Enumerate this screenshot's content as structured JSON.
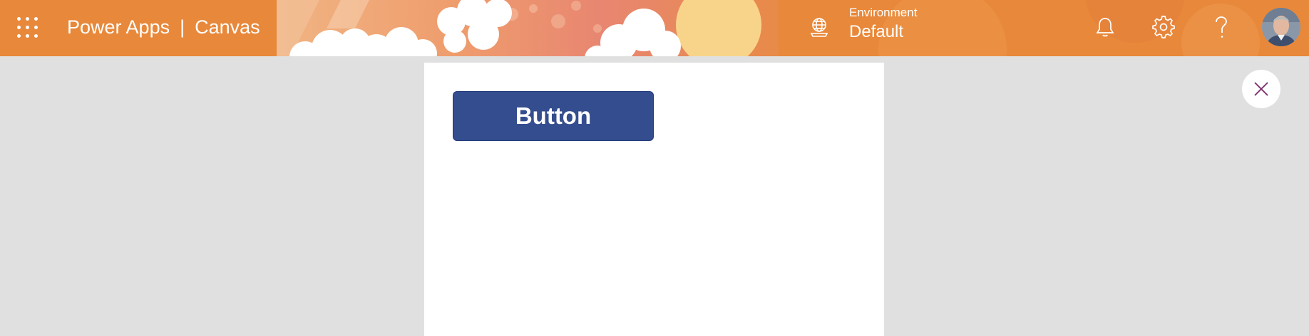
{
  "header": {
    "app_name": "Power Apps",
    "separator": "|",
    "section": "Canvas",
    "environment_label": "Environment",
    "environment_value": "Default",
    "icons": [
      "app-launcher-icon",
      "globe-icon",
      "bell-icon",
      "gear-icon",
      "help-icon",
      "avatar"
    ],
    "accent_color": "#e8883a"
  },
  "canvas": {
    "button_label": "Button",
    "button_color": "#344d8e"
  },
  "close": {
    "icon": "close-icon",
    "color": "#7a2b6e"
  }
}
